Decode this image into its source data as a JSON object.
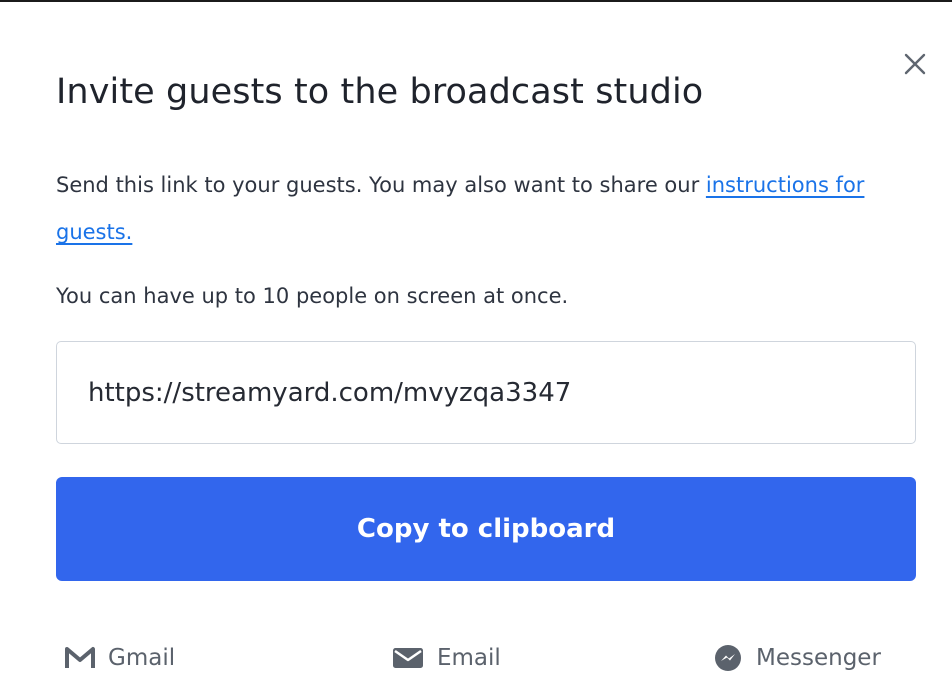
{
  "modal": {
    "close_icon": "close-icon",
    "title": "Invite guests to the broadcast studio",
    "description_text": "Send this link to your guests. You may also want to share our ",
    "instructions_link": "instructions for guests.",
    "limit_text": "You can have up to 10 people on screen at once.",
    "guest_link": "https://streamyard.com/mvyzqa3347",
    "copy_button_label": "Copy to clipboard",
    "primary_color": "#3266ED",
    "link_color": "#1A73E8",
    "share_options": [
      {
        "label": "Gmail",
        "icon": "gmail-icon"
      },
      {
        "label": "Email",
        "icon": "email-icon"
      },
      {
        "label": "Messenger",
        "icon": "messenger-icon"
      }
    ]
  }
}
